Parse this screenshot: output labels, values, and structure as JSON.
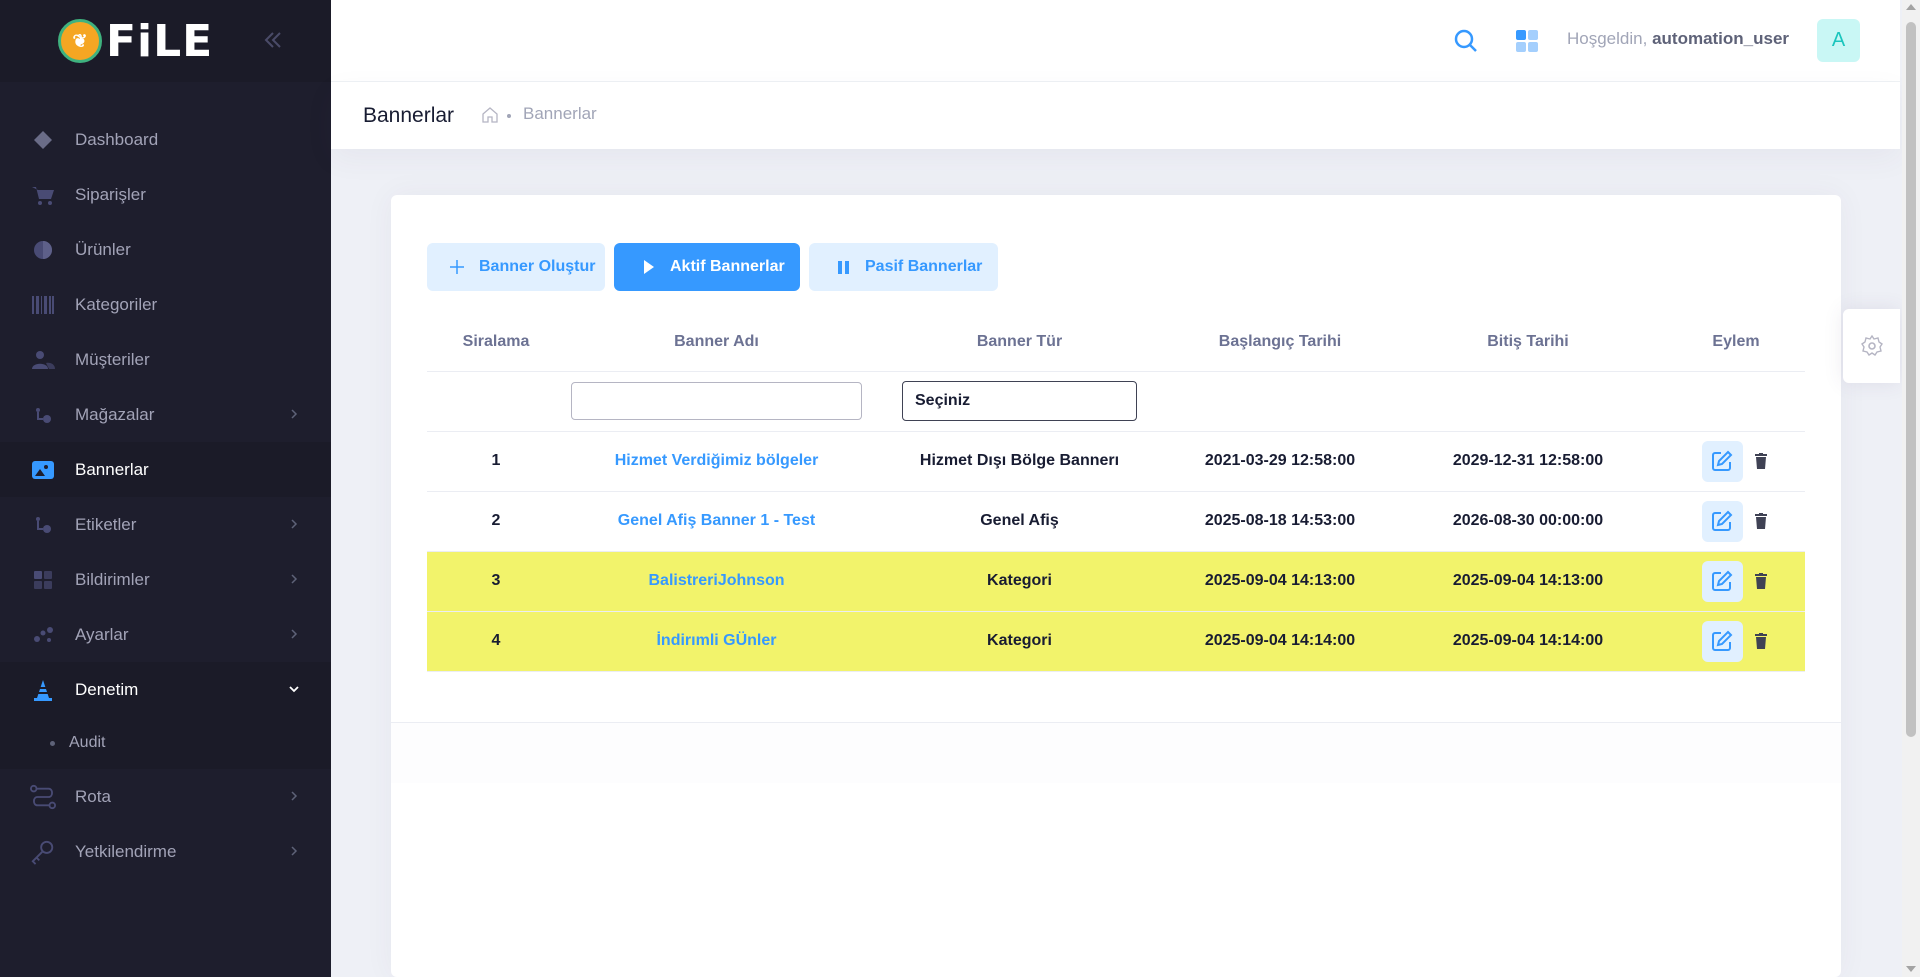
{
  "brand": {
    "logo_text": "FiLE"
  },
  "sidebar": {
    "items": [
      {
        "label": "Dashboard",
        "icon": "diamond-icon"
      },
      {
        "label": "Siparişler",
        "icon": "cart-icon"
      },
      {
        "label": "Ürünler",
        "icon": "box-icon"
      },
      {
        "label": "Kategoriler",
        "icon": "barcode-icon"
      },
      {
        "label": "Müşteriler",
        "icon": "users-icon"
      },
      {
        "label": "Mağazalar",
        "icon": "store-icon"
      },
      {
        "label": "Bannerlar",
        "icon": "image-icon"
      },
      {
        "label": "Etiketler",
        "icon": "tag-icon"
      },
      {
        "label": "Bildirimler",
        "icon": "grid-icon"
      },
      {
        "label": "Ayarlar",
        "icon": "settings-icon"
      },
      {
        "label": "Denetim",
        "icon": "cone-icon"
      },
      {
        "label": "Rota",
        "icon": "route-icon"
      },
      {
        "label": "Yetkilendirme",
        "icon": "key-icon"
      }
    ],
    "sub_items": [
      {
        "label": "Audit"
      }
    ]
  },
  "header": {
    "greeting": "Hoşgeldin,",
    "username": "automation_user",
    "avatar_letter": "A"
  },
  "subheader": {
    "title": "Bannerlar",
    "breadcrumb": "Bannerlar"
  },
  "toolbar": {
    "create_label": "Banner Oluştur",
    "active_label": "Aktif Bannerlar",
    "passive_label": "Pasif Bannerlar"
  },
  "table": {
    "columns": [
      "Siralama",
      "Banner Adı",
      "Banner Tür",
      "Başlangıç Tarihi",
      "Bitiş Tarihi",
      "Eylem"
    ],
    "filter_select": "Seçiniz",
    "rows": [
      {
        "order": "1",
        "name": "Hizmet Verdiğimiz bölgeler",
        "type": "Hizmet Dışı Bölge Bannerı",
        "start": "2021-03-29 12:58:00",
        "end": "2029-12-31 12:58:00"
      },
      {
        "order": "2",
        "name": "Genel Afiş Banner 1 - Test",
        "type": "Genel Afiş",
        "start": "2025-08-18 14:53:00",
        "end": "2026-08-30 00:00:00"
      },
      {
        "order": "3",
        "name": "BalistreriJohnson",
        "type": "Kategori",
        "start": "2025-09-04 14:13:00",
        "end": "2025-09-04 14:13:00"
      },
      {
        "order": "4",
        "name": "İndirımli GÜnler",
        "type": "Kategori",
        "start": "2025-09-04 14:14:00",
        "end": "2025-09-04 14:14:00"
      }
    ]
  },
  "colors": {
    "sidebar_bg": "#1e1e2d",
    "accent": "#3699ff",
    "highlight_row": "#f2f36b"
  }
}
